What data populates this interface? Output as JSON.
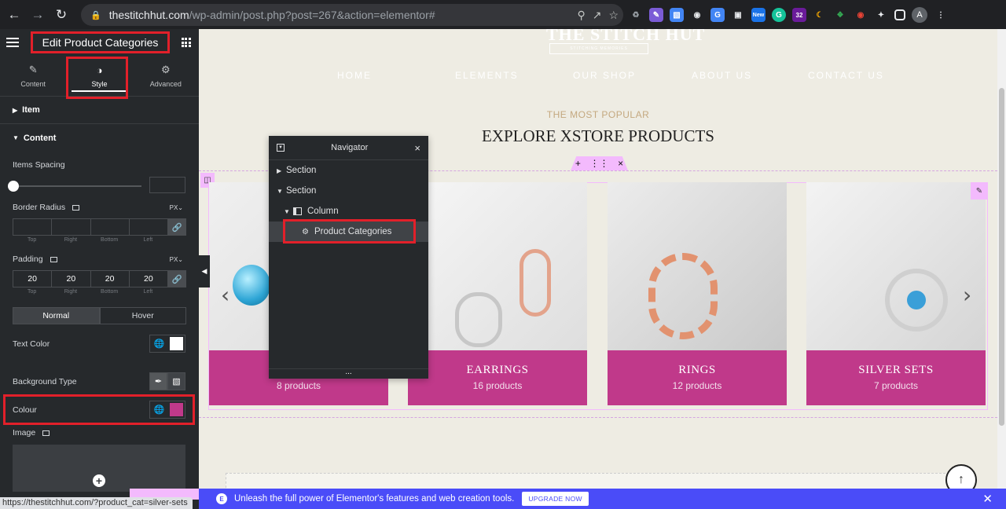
{
  "browser": {
    "url_host": "thestitchhut.com",
    "url_path": "/wp-admin/post.php?post=267&action=elementor#",
    "ext_badge_new": "New",
    "ext_badge_count": "32",
    "avatar_letter": "A"
  },
  "panel": {
    "title": "Edit Product Categories",
    "tabs": [
      {
        "label": "Content",
        "icon": "pencil-icon"
      },
      {
        "label": "Style",
        "icon": "contrast-icon"
      },
      {
        "label": "Advanced",
        "icon": "gear-icon"
      }
    ],
    "section_item": "Item",
    "section_content": "Content",
    "items_spacing_label": "Items Spacing",
    "items_spacing_value": "",
    "border_radius_label": "Border Radius",
    "border_radius_unit": "PX",
    "border_radius_values": [
      "",
      "",
      "",
      ""
    ],
    "dim_labels": [
      "Top",
      "Right",
      "Bottom",
      "Left"
    ],
    "padding_label": "Padding",
    "padding_unit": "PX",
    "padding_values": [
      "20",
      "20",
      "20",
      "20"
    ],
    "state_tabs": [
      "Normal",
      "Hover"
    ],
    "text_color_label": "Text Color",
    "text_color": "#ffffff",
    "bg_type_label": "Background Type",
    "colour_label": "Colour",
    "colour": "#c0398a",
    "image_label": "Image"
  },
  "status_url": "https://thestitchhut.com/?product_cat=silver-sets",
  "preview": {
    "logo": "THE STITCH HUT",
    "logo_sub": "STITCHING MEMORIES",
    "menu": [
      "HOME",
      "ELEMENTS",
      "OUR SHOP",
      "ABOUT US",
      "CONTACT US"
    ],
    "eyebrow": "THE MOST POPULAR",
    "heading": "EXPLORE XSTORE PRODUCTS",
    "categories": [
      {
        "name": "N",
        "count": "8 products"
      },
      {
        "name": "EARRINGS",
        "count": "16 products"
      },
      {
        "name": "RINGS",
        "count": "12 products"
      },
      {
        "name": "SILVER SETS",
        "count": "7 products"
      }
    ],
    "accent": "#c0398a"
  },
  "navigator": {
    "title": "Navigator",
    "items": [
      {
        "label": "Section",
        "level": 0,
        "expanded": false
      },
      {
        "label": "Section",
        "level": 0,
        "expanded": true
      },
      {
        "label": "Column",
        "level": 1,
        "expanded": true
      },
      {
        "label": "Product Categories",
        "level": 2,
        "selected": true
      }
    ],
    "footer": "..."
  },
  "banner": {
    "text": "Unleash the full power of Elementor's features and web creation tools.",
    "button": "UPGRADE NOW"
  }
}
